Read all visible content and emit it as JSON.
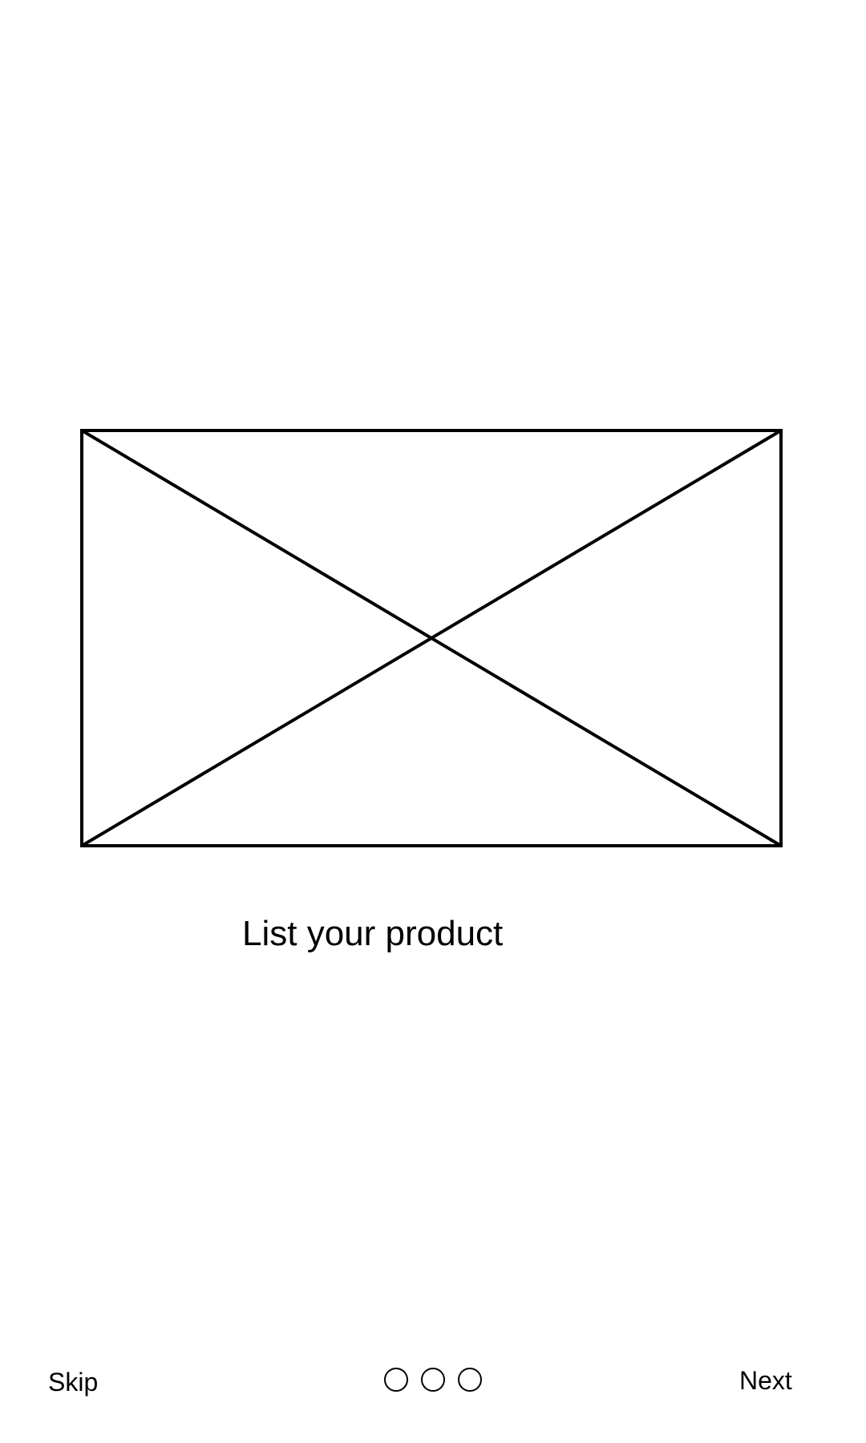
{
  "onboarding": {
    "title": "List your product",
    "image_icon": "image-placeholder-icon",
    "skip_label": "Skip",
    "next_label": "Next",
    "page_count": 3
  },
  "colors": {
    "background": "#ffffff",
    "foreground": "#000000"
  }
}
